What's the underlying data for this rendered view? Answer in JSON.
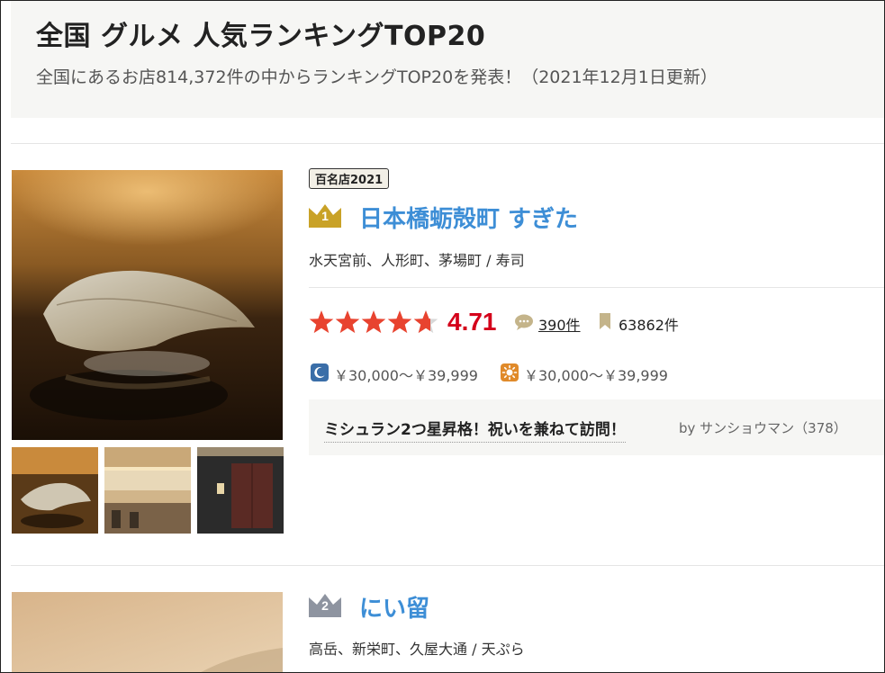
{
  "page": {
    "title": "全国 グルメ 人気ランキングTOP20",
    "subtitle": "全国にあるお店814,372件の中からランキングTOP20を発表！（2021年12月1日更新）"
  },
  "restaurants": [
    {
      "rank": "1",
      "badge": "百名店2021",
      "name": "日本橋蛎殻町 すぎた",
      "area_genre": "水天宮前、人形町、茅場町 / 寿司",
      "rating": "4.71",
      "stars": 4.71,
      "reviews": "390件",
      "bookmarks": "63862件",
      "dinner_price": "￥30,000～￥39,999",
      "lunch_price": "￥30,000～￥39,999",
      "review_title": "ミシュラン2つ星昇格！祝いを兼ねて訪問！",
      "review_by": "by サンショウマン（378）"
    },
    {
      "rank": "2",
      "name": "にい留",
      "area_genre": "高岳、新栄町、久屋大通 / 天ぷら"
    }
  ],
  "colors": {
    "name_link": "#3d8ed6",
    "rating": "#d4001a",
    "star": "#e8432f",
    "gold_rank": "#c9a227",
    "silver_rank": "#8e94a0",
    "dinner_icon": "#3a6ea8",
    "lunch_icon": "#e08a2a"
  },
  "icons": {
    "dinner": "moon-icon",
    "lunch": "sun-icon",
    "review": "speech-bubble-icon",
    "bookmark": "bookmark-icon",
    "rank": "crown-icon"
  }
}
